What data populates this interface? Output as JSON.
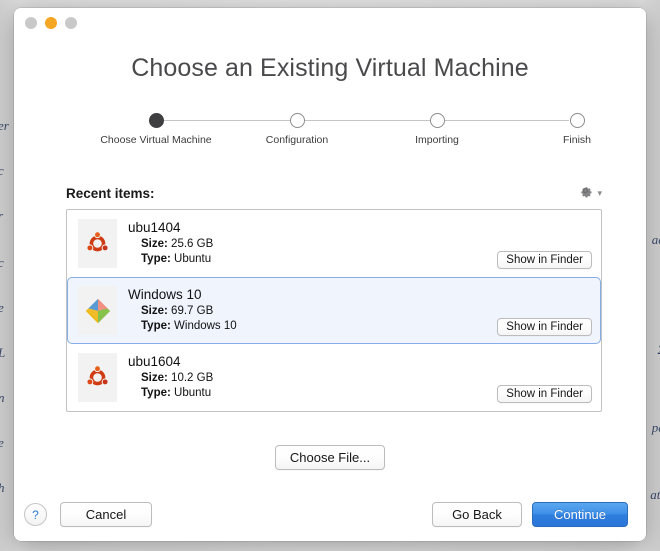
{
  "background": {
    "left_fragments": [
      "er",
      "c",
      "r",
      "c",
      "e",
      "L",
      "n",
      "e",
      "h"
    ],
    "right_fragments": [
      "ac",
      "2",
      "pe",
      "ati"
    ]
  },
  "window": {
    "traffic_lights": [
      "close-button",
      "minimize-button",
      "zoom-button"
    ],
    "title": "Choose an Existing Virtual Machine"
  },
  "stepper": {
    "steps": [
      {
        "label": "Choose Virtual Machine",
        "state": "done"
      },
      {
        "label": "Configuration",
        "state": "todo"
      },
      {
        "label": "Importing",
        "state": "todo"
      },
      {
        "label": "Finish",
        "state": "todo"
      }
    ]
  },
  "recent": {
    "label": "Recent items:",
    "gear_icon": "gear-icon",
    "chevron_icon": "chevron-down-icon",
    "show_in_finder_label": "Show in Finder",
    "size_key": "Size:",
    "type_key": "Type:",
    "items": [
      {
        "name": "ubu1404",
        "size": "25.6 GB",
        "type": "Ubuntu",
        "icon": "ubuntu-icon",
        "selected": false
      },
      {
        "name": "Windows 10",
        "size": "69.7 GB",
        "type": "Windows 10",
        "icon": "windows-icon",
        "selected": true
      },
      {
        "name": "ubu1604",
        "size": "10.2 GB",
        "type": "Ubuntu",
        "icon": "ubuntu-icon",
        "selected": false
      }
    ]
  },
  "actions": {
    "choose_file": "Choose File...",
    "help": "?",
    "cancel": "Cancel",
    "go_back": "Go Back",
    "continue": "Continue"
  },
  "colors": {
    "accent_blue": "#2f7ede",
    "selection_bg": "#eff4fd",
    "selection_border": "#86aee6",
    "minimize_yellow": "#f5a623",
    "step_done": "#3f3f41",
    "help_blue": "#2b7cd6"
  }
}
